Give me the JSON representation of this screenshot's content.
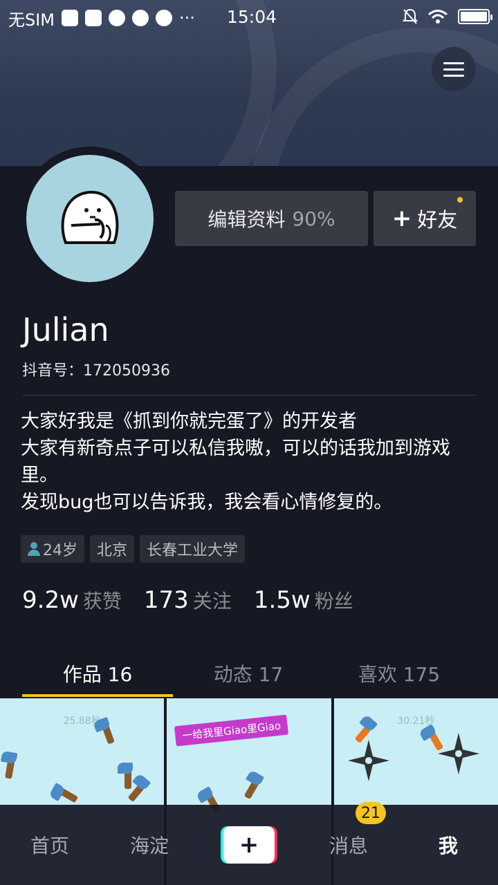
{
  "status_bar": {
    "carrier": "无SIM",
    "time": "15:04",
    "more": "···",
    "battery_level": 1.0
  },
  "profile": {
    "name": "Julian",
    "douyin_id": "抖音号：172050936",
    "edit_button": "编辑资料",
    "edit_percent": "90%",
    "add_friend_plus": "+",
    "add_friend_label": "好友",
    "bio": [
      "大家好我是《抓到你就完蛋了》的开发者",
      "大家有新奇点子可以私信我嗷，可以的话我加到游戏里。",
      "发现bug也可以告诉我，我会看心情修复的。"
    ],
    "tags": {
      "age": "24岁",
      "city": "北京",
      "school": "长春工业大学"
    },
    "stats": [
      {
        "num": "9.2w",
        "label": "获赞"
      },
      {
        "num": "173",
        "label": "关注"
      },
      {
        "num": "1.5w",
        "label": "粉丝"
      }
    ]
  },
  "tabs": [
    {
      "label": "作品 16"
    },
    {
      "label": "动态 17"
    },
    {
      "label": "喜欢 175"
    }
  ],
  "grid": [
    {
      "timer": "25.88秒"
    },
    {
      "timer": "",
      "banner": "一给我里Giao里Giao"
    },
    {
      "timer": "30.21秒"
    }
  ],
  "bottom_nav": {
    "home": "首页",
    "location": "海淀",
    "plus": "+",
    "messages": "消息",
    "messages_badge": "21",
    "me": "我"
  },
  "colors": {
    "accent": "#f7c325",
    "background": "#161823",
    "button_bg": "#393b44"
  }
}
